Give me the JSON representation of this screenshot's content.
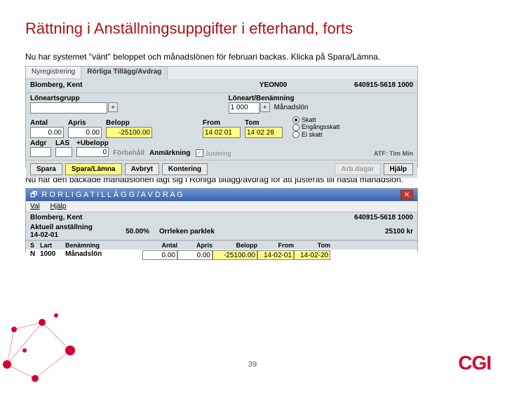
{
  "title": "Rättning i Anställningsuppgifter i efterhand, forts",
  "para1": "Nu har systemet \"vänt\" beloppet och månadslönen för februari backas. Klicka på Spara/Lämna.",
  "para2": "Nu har den backade månadslönen lagt sig i Rörliga tillägg/avdrag för att justeras till nästa månadslön.",
  "pageno": "39",
  "logo": "CGI",
  "panel1": {
    "tab1": "Nyregistrering",
    "tab2": "Rörliga Tillägg/Avdrag",
    "name": "Blomberg, Kent",
    "code": "YEON00",
    "pnr": "640915-5618 1000",
    "l_loneartsgrupp": "Löneartsgrupp",
    "l_loneart": "Löneart/Benämning",
    "loneart_val": "1 000",
    "loneart_txt": "Månadslön",
    "c_antal": "Antal",
    "c_apris": "Apris",
    "c_belopp": "Belopp",
    "c_from": "From",
    "c_tom": "Tom",
    "v_antal": "0.00",
    "v_apris": "0.00",
    "v_belopp": "-25100.00",
    "v_from": "14 02 01",
    "v_tom": "14 02 28",
    "c_adgr": "Adgr",
    "c_las": "LAS",
    "c_ubelopp": "+Ubelopp",
    "c_forbehall": "Förbehåll",
    "c_anm": "Anmärkning",
    "c_just": "Justering",
    "v_ubelopp": "0",
    "rs": "Skatt",
    "re": "Engångsskatt",
    "rei": "Ei skatt",
    "l_atf": "ATF: Tim    Min",
    "b_spara": "Spara",
    "b_sparalamna": "Spara/Lämna",
    "b_avbryt": "Avbryt",
    "b_kontering": "Kontering",
    "b_arbdagar": "Arb.dagar",
    "b_hjalp": "Hjälp"
  },
  "panel2": {
    "win": "R O R L I G A   T I L L Ä G G / A V D R A G",
    "m_val": "Val",
    "m_hjalp": "Hjälp",
    "name": "Blomberg, Kent",
    "pnr": "640915-5618 1000",
    "aktuell": "Aktuell anställning",
    "datum": "14-02-01",
    "pct": "50.00%",
    "orr": "Orrleken parklek",
    "kr": "25100 kr",
    "h_s": "S",
    "h_lart": "Lart",
    "h_ben": "Benämning",
    "h_antal": "Antal",
    "h_apris": "Apris",
    "h_belopp": "Belopp",
    "h_from": "From",
    "h_tom": "Tom",
    "r_s": "N",
    "r_lart": "1000",
    "r_ben": "Månadslön",
    "r_antal": "0.00",
    "r_apris": "0.00",
    "r_belopp": "-25100.00",
    "r_from": "14-02-01",
    "r_tom": "14-02-20"
  }
}
